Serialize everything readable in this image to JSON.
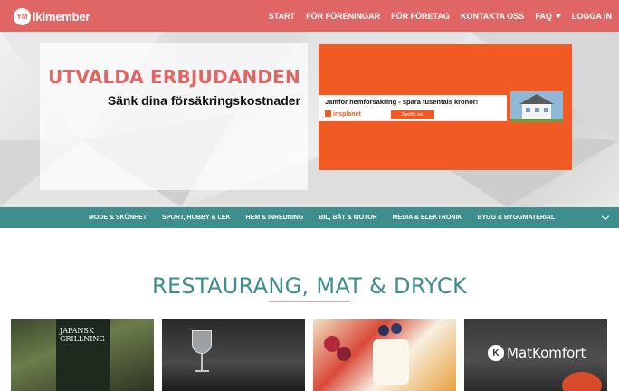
{
  "brand": {
    "logo_mark": "YM",
    "name": "lkimember"
  },
  "nav": {
    "items": [
      "START",
      "FÖR FÖRENINGAR",
      "FÖR FÖRETAG",
      "KONTAKTA OSS"
    ],
    "faq_label": "FAQ",
    "login_label": "LOGGA IN"
  },
  "hero": {
    "title": "UTVALDA ERBJUDANDEN",
    "subtitle": "Sänk dina försäkringskostnader",
    "ad": {
      "headline": "Jämför hemförsäkring - spara tusentals kronor!",
      "brand": "insplanet",
      "cta": "Jämför nu!"
    }
  },
  "categories": {
    "items": [
      "MODE & SKÖNHET",
      "SPORT, HOBBY & LEK",
      "HEM & INREDNING",
      "BIL, BÅT & MOTOR",
      "MEDIA & ELEKTRONIK",
      "BYGG & BYGGMATERIAL"
    ]
  },
  "section": {
    "title": "RESTAURANG, MAT & DRYCK"
  },
  "cards": {
    "card1_text": "JAPANSK GRILLNING",
    "card4_brand": "MatKomfort",
    "card4_icon": "K"
  },
  "colors": {
    "brand": "#e06666",
    "accent": "#3e8e8e",
    "ad": "#f15a22"
  }
}
